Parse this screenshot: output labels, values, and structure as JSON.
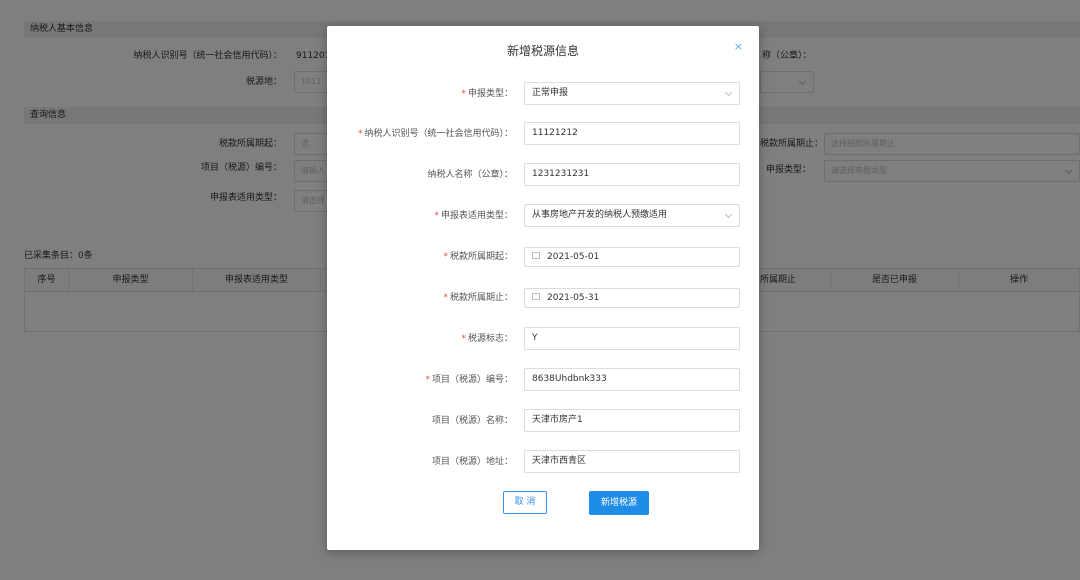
{
  "background": {
    "section_basic": "纳税人基本信息",
    "taxpayer_id_label": "纳税人识别号（统一社会信用代码）：",
    "taxpayer_id_value": "911201",
    "name_label_tail": "称（公章）：",
    "tax_location_label": "税源地：",
    "tax_location_value": "1011",
    "section_query": "查询信息",
    "period_start_label": "税款所属期起：",
    "period_start_placeholder": "选",
    "period_end_label": "税款所属期止：",
    "period_end_placeholder": "选择税款所属期止",
    "project_no_label": "项目（税源）编号：",
    "project_no_placeholder": "请输入",
    "declare_type_label": "申报类型：",
    "declare_type_placeholder": "请选择申报类型",
    "form_type_label": "申报表适用类型：",
    "form_type_placeholder": "请选择",
    "collected_count": "已采集条目：0条",
    "table_headers": [
      "序号",
      "申报类型",
      "申报表适用类型",
      "所属期止",
      "是否已申报",
      "操作"
    ]
  },
  "modal": {
    "title": "新增税源信息",
    "close": "×",
    "fields": [
      {
        "label": "申报类型：",
        "required": "*",
        "value": "正常申报",
        "type": "select"
      },
      {
        "label": "纳税人识别号（统一社会信用代码）：",
        "required": "*",
        "value": "11121212",
        "type": "text"
      },
      {
        "label": "纳税人名称（公章）：",
        "required": "",
        "value": "1231231231",
        "type": "text"
      },
      {
        "label": "申报表适用类型：",
        "required": "*",
        "value": "从事房地产开发的纳税人预缴适用",
        "type": "select"
      },
      {
        "label": "税款所属期起：",
        "required": "*",
        "value": "2021-05-01",
        "type": "date"
      },
      {
        "label": "税款所属期止：",
        "required": "*",
        "value": "2021-05-31",
        "type": "date"
      },
      {
        "label": "税源标志：",
        "required": "*",
        "value": "Y",
        "type": "text"
      },
      {
        "label": "项目（税源）编号：",
        "required": "*",
        "value": "8638Uhdbnk333",
        "type": "text"
      },
      {
        "label": "项目（税源）名称：",
        "required": "",
        "value": "天津市房产1",
        "type": "text"
      },
      {
        "label": "项目（税源）地址：",
        "required": "",
        "value": "天津市西青区",
        "type": "text"
      }
    ],
    "cancel_label": "取 消",
    "submit_label": "新增税源"
  }
}
